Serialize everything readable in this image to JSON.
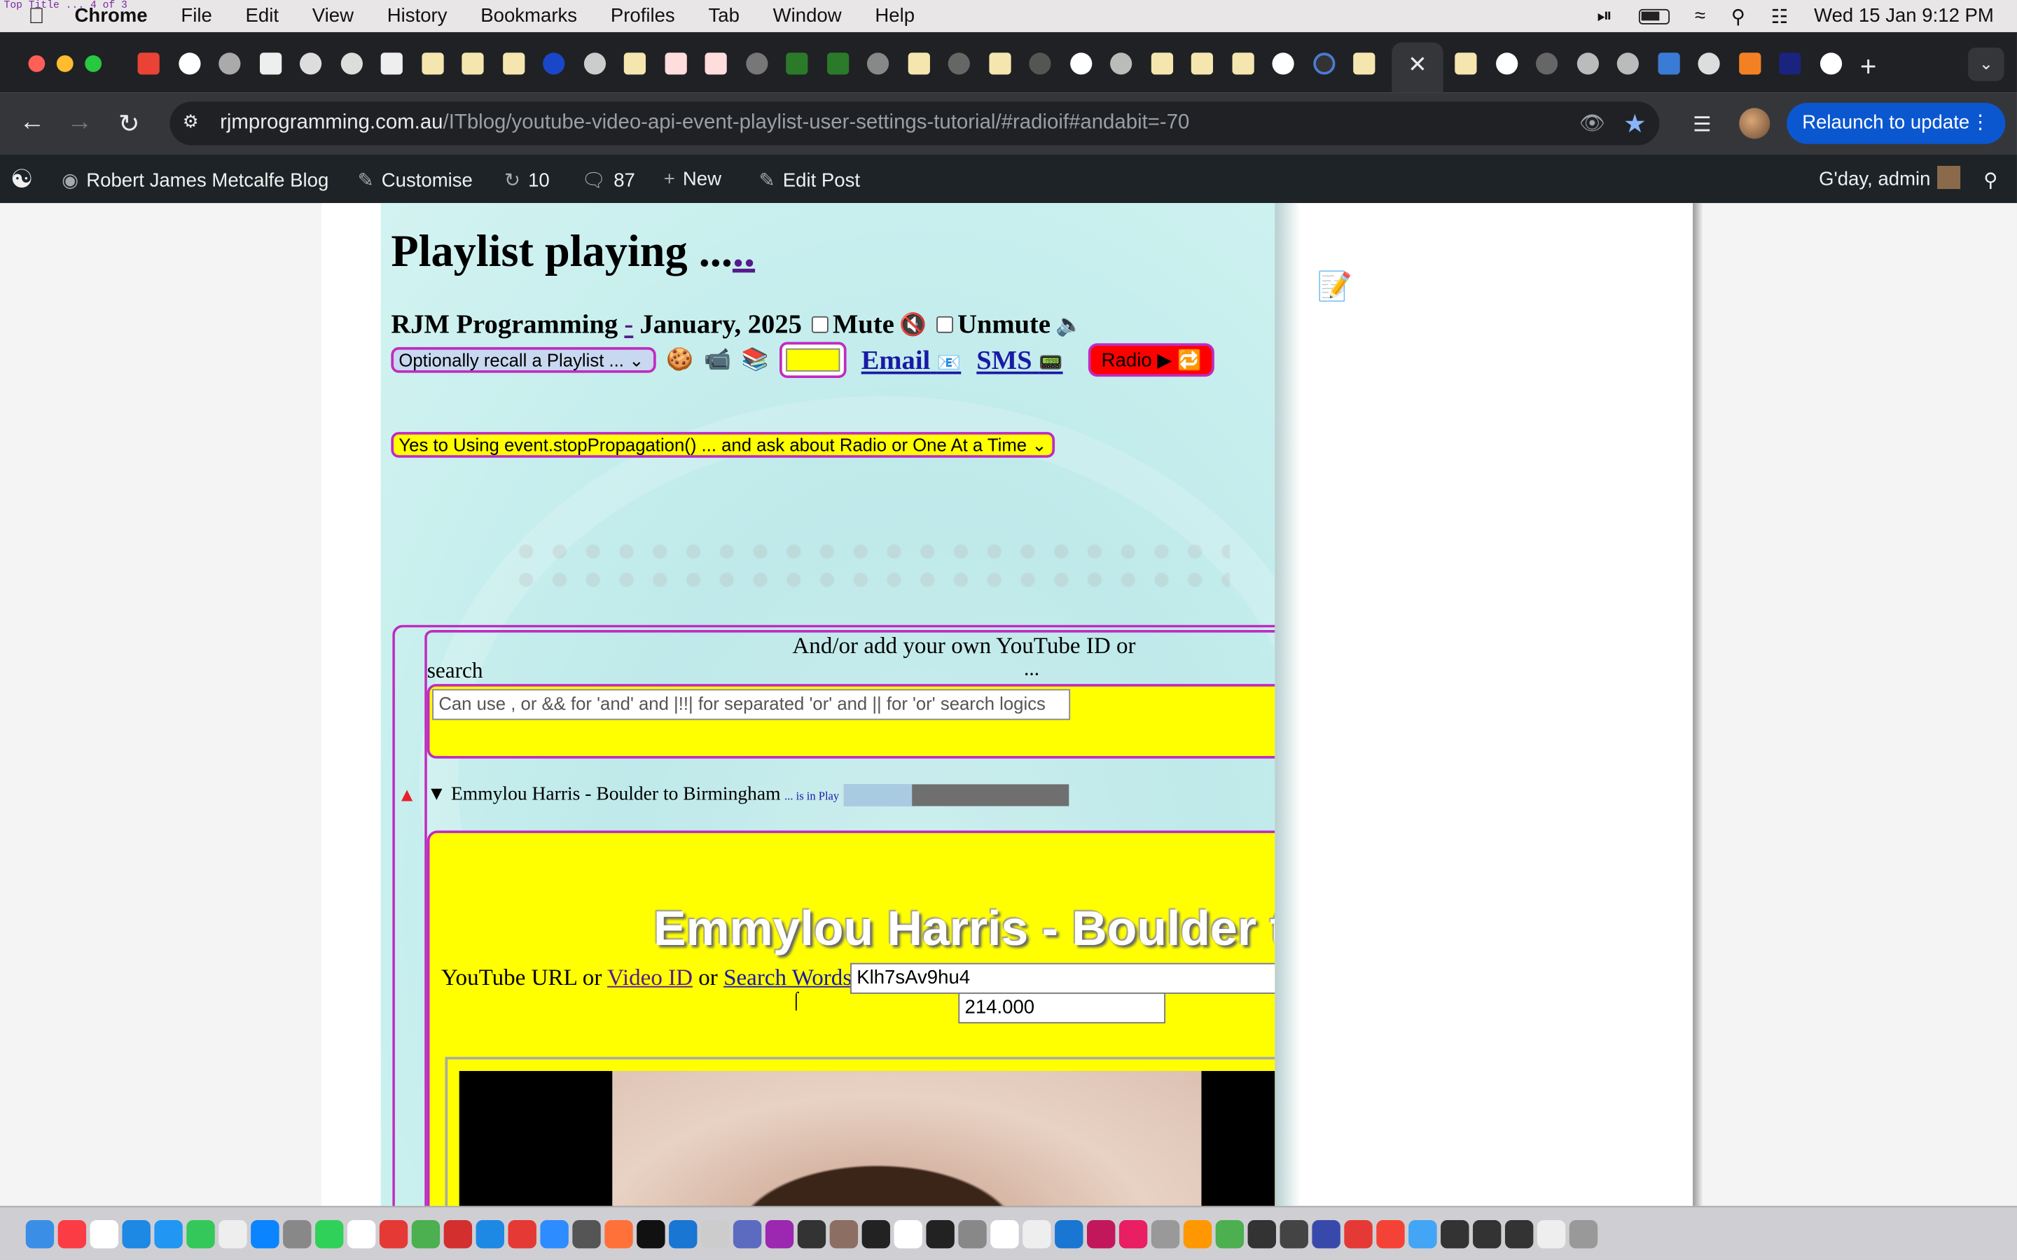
{
  "menubar": {
    "app": "Chrome",
    "items": [
      "File",
      "Edit",
      "View",
      "History",
      "Bookmarks",
      "Profiles",
      "Tab",
      "Window",
      "Help"
    ],
    "datetime": "Wed 15 Jan  9:12 PM",
    "topleft_text": "Top Title ... 4 of 3"
  },
  "toolbar": {
    "url_host": "rjmprogramming.com.au",
    "url_path": "/ITblog/youtube-video-api-event-playlist-user-settings-tutorial/#radioif#andabit=-70",
    "relaunch_label": "Relaunch to update"
  },
  "wpbar": {
    "site": "Robert James Metcalfe Blog",
    "customise": "Customise",
    "updates": "10",
    "comments": "87",
    "new": "New",
    "edit_post": "Edit Post",
    "greeting": "G'day, admin"
  },
  "page": {
    "title": "Playlist playing ...",
    "title_link": "..",
    "byline": "RJM Programming",
    "byline_sep": "-",
    "byline_date": "January, 2025",
    "mute_label": "Mute",
    "unmute_label": "Unmute",
    "recall_select": "Optionally recall a Playlist ...",
    "email_label": "Email",
    "sms_label": "SMS",
    "radio_label": "Radio ▶",
    "yes_select": "Yes to Using event.stopPropagation() ... and ask about Radio or One At a Time",
    "add_own": "And/or add your own YouTube ID or",
    "add_own_dots": "...",
    "search_label": "search",
    "search_placeholder": "Can use , or && for 'and' and |!!| for separated 'or' and || for 'or' search logics",
    "song_title": "Emmylou Harris - Boulder to Birmingham",
    "song_status": "... is in Play",
    "song_progress": 0.3,
    "big_title": "Emmylou Harris - Boulder to Bi",
    "yt_label_prefix": "YouTube URL or",
    "yt_label_video_id": "Video ID",
    "yt_label_or": "or",
    "yt_label_search": "Search Words",
    "yt_label_colon": ":",
    "video_id_value": "Klh7sAv9hu4",
    "time_value": "214.000"
  }
}
